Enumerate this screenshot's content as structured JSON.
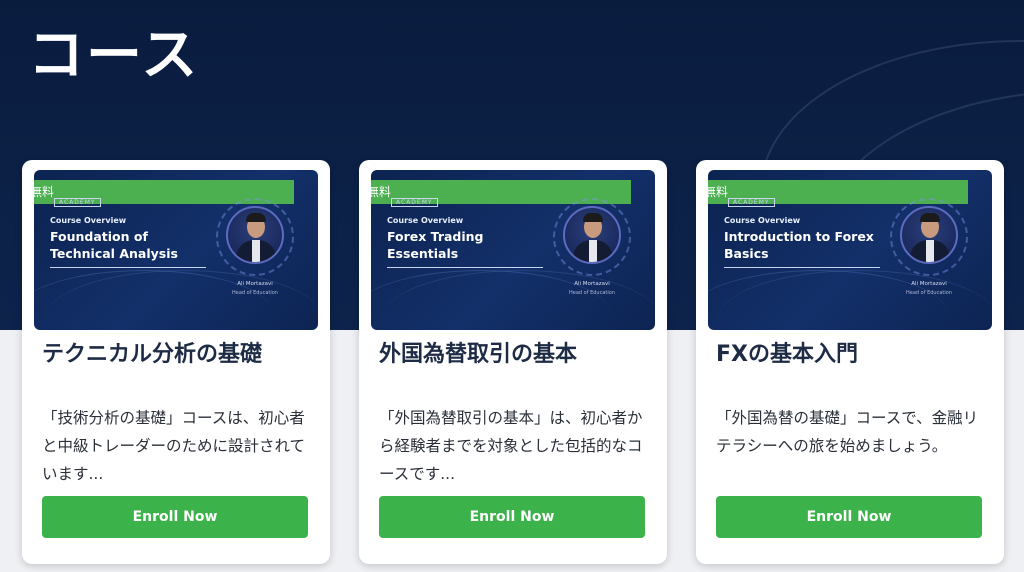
{
  "page": {
    "title": "コース"
  },
  "cards": [
    {
      "badge": "無料",
      "academy": "ACADEMY",
      "overview": "Course Overview",
      "thumb_title": "Foundation of Technical Analysis",
      "presenter_name": "Ali Mortazavi",
      "presenter_role": "Head of Education",
      "title": "テクニカル分析の基礎",
      "description": "「技術分析の基礎」コースは、初心者と中級トレーダーのために設計されています...",
      "button": "Enroll Now"
    },
    {
      "badge": "無料",
      "academy": "ACADEMY",
      "overview": "Course Overview",
      "thumb_title": "Forex Trading Essentials",
      "presenter_name": "Ali Mortazavi",
      "presenter_role": "Head of Education",
      "title": "外国為替取引の基本",
      "description": "「外国為替取引の基本」は、初心者から経験者までを対象とした包括的なコースです...",
      "button": "Enroll Now"
    },
    {
      "badge": "無料",
      "academy": "ACADEMY",
      "overview": "Course Overview",
      "thumb_title": "Introduction to Forex Basics",
      "presenter_name": "Ali Mortazavi",
      "presenter_role": "Head of Education",
      "title": "FXの基本入門",
      "description": "「外国為替の基礎」コースで、金融リテラシーへの旅を始めましょう。",
      "button": "Enroll Now"
    }
  ],
  "colors": {
    "hero": "#0c2147",
    "badge": "#4caf50",
    "button": "#3cb34a"
  },
  "icons": {
    "presenter": "person-avatar-icon"
  }
}
